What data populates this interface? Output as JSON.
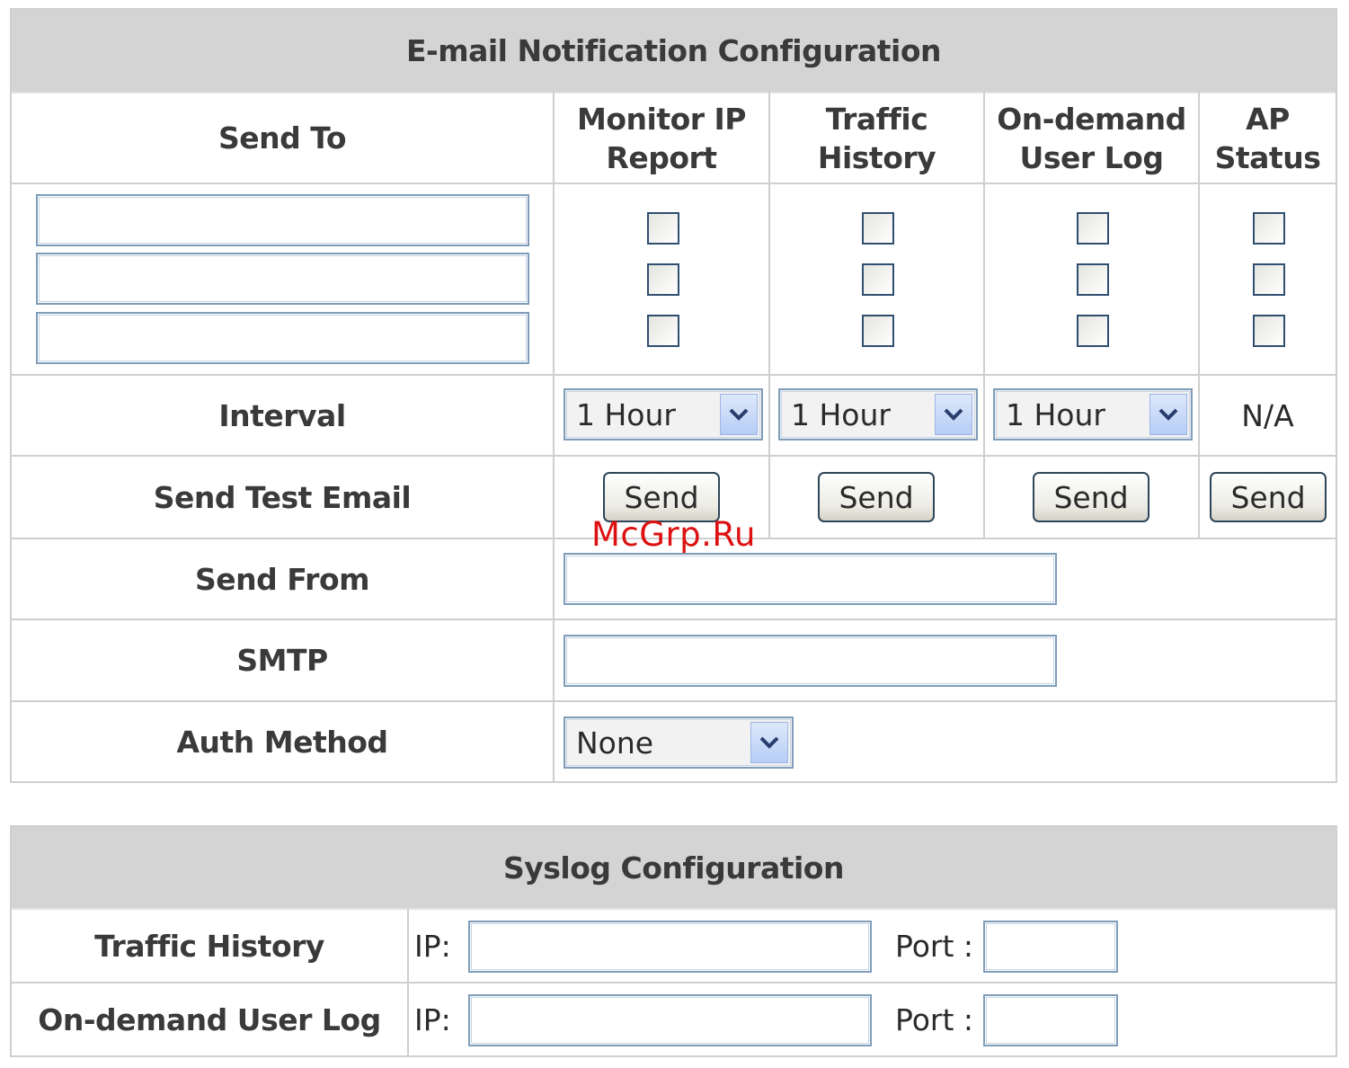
{
  "email": {
    "title": "E-mail Notification Configuration",
    "send_to_header": "Send To",
    "columns": [
      {
        "header_line1": "Monitor IP",
        "header_line2": "Report",
        "interval": "1 Hour",
        "send_label": "Send",
        "checked": [
          false,
          false,
          false
        ]
      },
      {
        "header_line1": "Traffic",
        "header_line2": "History",
        "interval": "1 Hour",
        "send_label": "Send",
        "checked": [
          false,
          false,
          false
        ]
      },
      {
        "header_line1": "On-demand",
        "header_line2": "User Log",
        "interval": "1 Hour",
        "send_label": "Send",
        "checked": [
          false,
          false,
          false
        ]
      },
      {
        "header_line1": "AP",
        "header_line2": "Status",
        "interval": "N/A",
        "send_label": "Send",
        "checked": [
          false,
          false,
          false
        ]
      }
    ],
    "send_to_values": [
      "",
      "",
      ""
    ],
    "interval_label": "Interval",
    "send_test_label": "Send Test Email",
    "send_from_label": "Send From",
    "send_from_value": "",
    "smtp_label": "SMTP",
    "smtp_value": "",
    "auth_label": "Auth Method",
    "auth_value": "None"
  },
  "syslog": {
    "title": "Syslog Configuration",
    "rows": [
      {
        "label": "Traffic History",
        "ip_label": "IP:",
        "ip_value": "",
        "port_label": "Port :",
        "port_value": ""
      },
      {
        "label": "On-demand User Log",
        "ip_label": "IP:",
        "ip_value": "",
        "port_label": "Port :",
        "port_value": ""
      }
    ]
  },
  "watermark": "McGrp.Ru",
  "colors": {
    "header_bg": "#d4d4d4",
    "border": "#cfcfcf",
    "field_border": "#7f9db9",
    "watermark": "#dd1111"
  },
  "icons": {
    "dropdown_arrow": "chevron-down-icon"
  }
}
